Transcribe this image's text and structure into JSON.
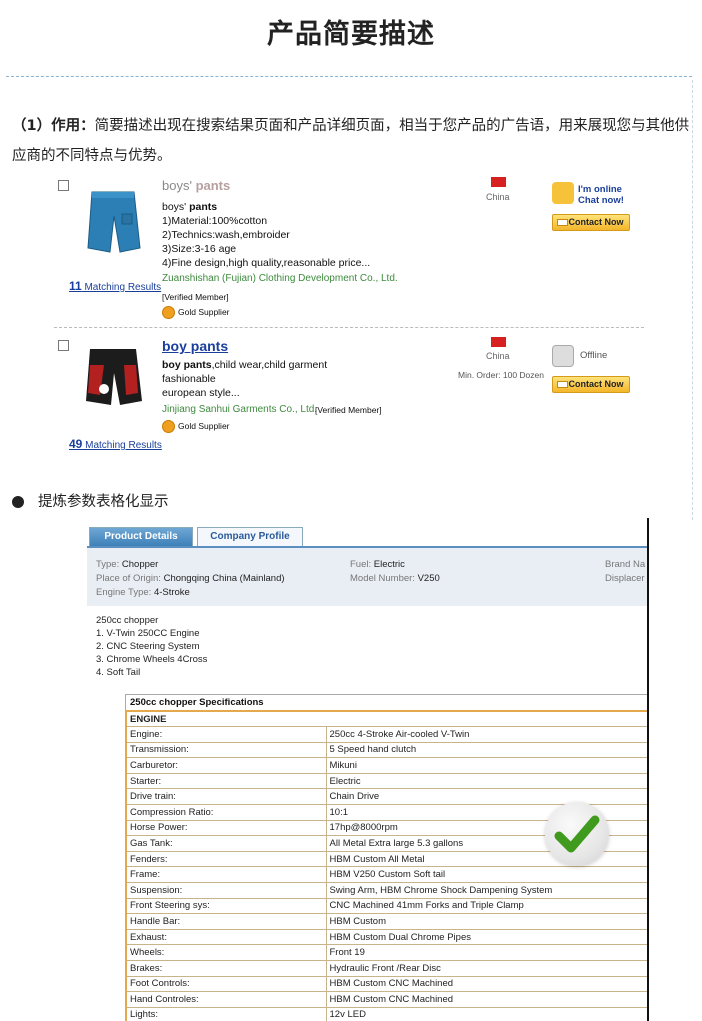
{
  "header": {
    "title": "产品简要描述"
  },
  "intro": {
    "label": "（1）作用：",
    "text": "简要描述出现在搜索结果页面和产品详细页面，相当于您产品的广告语，用来展现您与其他供应商的不同特点与优势。"
  },
  "results": [
    {
      "title_prefix": "boys' ",
      "title_bold": "pants",
      "desc_prefix": "boys' ",
      "desc_bold": "pants",
      "lines": [
        "1)Material:100%cotton",
        "2)Technics:wash,embroider",
        "3)Size:3-16 age",
        "4)Fine design,high quality,reasonable price..."
      ],
      "company": "Zuanshishan (Fujian) Clothing Development Co., Ltd.",
      "verified": "[Verified Member]",
      "gold": "Gold Supplier",
      "country": "China",
      "status": "I'm online Chat now!",
      "contact": "Contact Now",
      "matching_count": "11",
      "matching_text": " Matching Results"
    },
    {
      "title": "boy pants",
      "desc_bold": "boy pants",
      "desc_rest": ",child wear,child garment",
      "lines": [
        "fashionable",
        "european style..."
      ],
      "company": "Jinjiang Sanhui Garments Co., Ltd.",
      "verified": "[Verified Member]",
      "gold": "Gold Supplier",
      "country": "China",
      "min_order": "Min. Order: 100 Dozen",
      "status": "Offline",
      "contact": "Contact Now",
      "matching_count": "49",
      "matching_text": " Matching Results"
    }
  ],
  "bullet": {
    "text": "提炼参数表格化显示"
  },
  "product_details": {
    "tabs": [
      "Product Details",
      "Company Profile"
    ],
    "attributes": {
      "type_label": "Type:",
      "type_value": "Chopper",
      "origin_label": "Place of Origin:",
      "origin_value": "Chongqing China (Mainland)",
      "engine_type_label": "Engine Type:",
      "engine_type_value": "4-Stroke",
      "fuel_label": "Fuel:",
      "fuel_value": "Electric",
      "model_label": "Model Number:",
      "model_value": "V250",
      "brand_label": "Brand Na",
      "displacement_label": "Displacer"
    },
    "features": [
      "250cc chopper",
      "1. V-Twin 250CC Engine",
      "2. CNC Steering System",
      "3. Chrome Wheels 4Cross",
      "4. Soft Tail"
    ],
    "spec_title": "250cc chopper Specifications",
    "spec_section": "ENGINE",
    "spec_rows": [
      [
        "Engine:",
        "250cc 4-Stroke Air-cooled V-Twin"
      ],
      [
        "Transmission:",
        "5 Speed hand clutch"
      ],
      [
        "Carburetor:",
        "Mikuni"
      ],
      [
        "Starter:",
        "Electric"
      ],
      [
        "Drive train:",
        "Chain Drive"
      ],
      [
        "Compression Ratio:",
        "10:1"
      ],
      [
        "Horse Power:",
        "17hp@8000rpm"
      ],
      [
        "Gas Tank:",
        "All Metal Extra large 5.3 gallons"
      ],
      [
        "Fenders:",
        "HBM Custom All Metal"
      ],
      [
        "Frame:",
        "HBM V250 Custom Soft tail"
      ],
      [
        "Suspension:",
        "Swing Arm, HBM Chrome Shock Dampening System"
      ],
      [
        "Front Steering sys:",
        "CNC Machined 41mm Forks and Triple Clamp"
      ],
      [
        "Handle Bar:",
        "HBM Custom"
      ],
      [
        "Exhaust:",
        "HBM Custom Dual Chrome Pipes"
      ],
      [
        "Wheels:",
        "Front 19"
      ],
      [
        "Brakes:",
        "Hydraulic Front /Rear Disc"
      ],
      [
        "Foot Controls:",
        "HBM Custom CNC Machined"
      ],
      [
        "Hand Controles:",
        "HBM Custom CNC Machined"
      ],
      [
        "Lights:",
        "12v LED"
      ]
    ]
  },
  "colors": {
    "link": "#1a3f9a",
    "company": "#3e8a3e",
    "tab_active": "#3d80b8",
    "table_border": "#e3a94a",
    "check": "#3f9a1e"
  }
}
